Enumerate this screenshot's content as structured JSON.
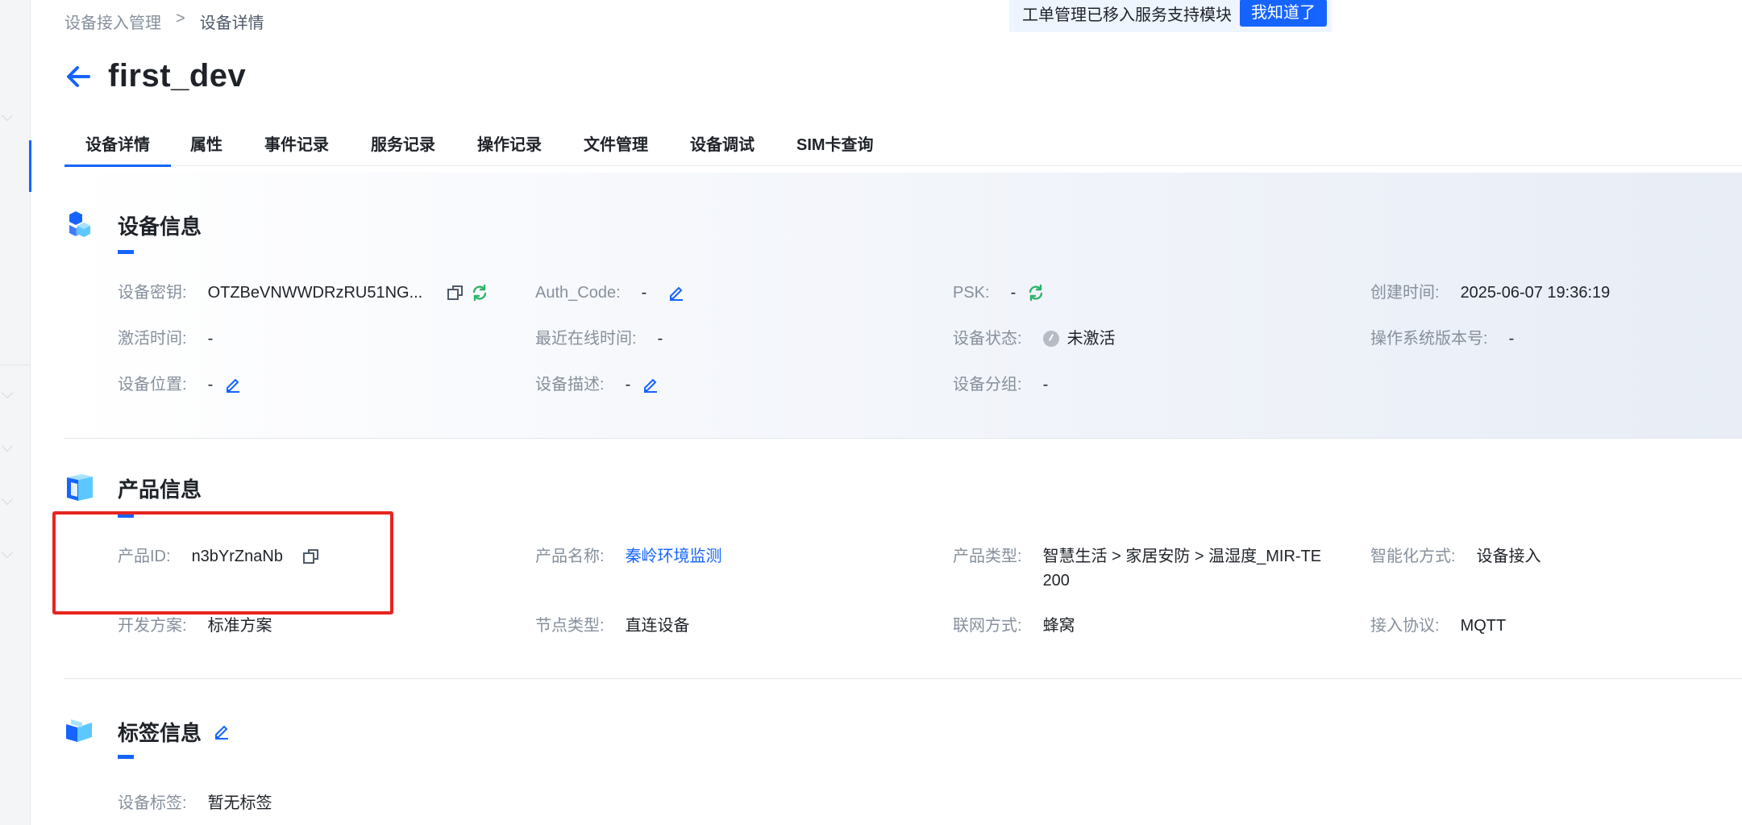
{
  "breadcrumb": {
    "parent": "设备接入管理",
    "separator": ">",
    "current": "设备详情"
  },
  "notice": {
    "text": "工单管理已移入服务支持模块",
    "button": "我知道了"
  },
  "header": {
    "title": "first_dev"
  },
  "tabs": [
    "设备详情",
    "属性",
    "事件记录",
    "服务记录",
    "操作记录",
    "文件管理",
    "设备调试",
    "SIM卡查询"
  ],
  "device_info": {
    "title": "设备信息",
    "secret": {
      "label": "设备密钥:",
      "value": "OTZBeVNWWDRzRU51NG..."
    },
    "auth_code": {
      "label": "Auth_Code:",
      "value": "-"
    },
    "psk": {
      "label": "PSK:",
      "value": "-"
    },
    "created": {
      "label": "创建时间:",
      "value": "2025-06-07 19:36:19"
    },
    "activated": {
      "label": "激活时间:",
      "value": "-"
    },
    "last_online": {
      "label": "最近在线时间:",
      "value": "-"
    },
    "status": {
      "label": "设备状态:",
      "value": "未激活"
    },
    "os_version": {
      "label": "操作系统版本号:",
      "value": "-"
    },
    "location": {
      "label": "设备位置:",
      "value": "-"
    },
    "description": {
      "label": "设备描述:",
      "value": "-"
    },
    "group": {
      "label": "设备分组:",
      "value": "-"
    }
  },
  "product_info": {
    "title": "产品信息",
    "product_id": {
      "label": "产品ID:",
      "value": "n3bYrZnaNb"
    },
    "product_name": {
      "label": "产品名称:",
      "value": "秦岭环境监测"
    },
    "product_type": {
      "label": "产品类型:",
      "value": "智慧生活 > 家居安防 > 温湿度_MIR-TE200"
    },
    "intelligence": {
      "label": "智能化方式:",
      "value": "设备接入"
    },
    "dev_scheme": {
      "label": "开发方案:",
      "value": "标准方案"
    },
    "node_type": {
      "label": "节点类型:",
      "value": "直连设备"
    },
    "network": {
      "label": "联网方式:",
      "value": "蜂窝"
    },
    "protocol": {
      "label": "接入协议:",
      "value": "MQTT"
    }
  },
  "tag_info": {
    "title": "标签信息",
    "tags": {
      "label": "设备标签:",
      "value": "暂无标签"
    }
  },
  "colors": {
    "accent": "#1664ff",
    "refresh": "#2fb36b",
    "highlight": "#e8241f"
  }
}
